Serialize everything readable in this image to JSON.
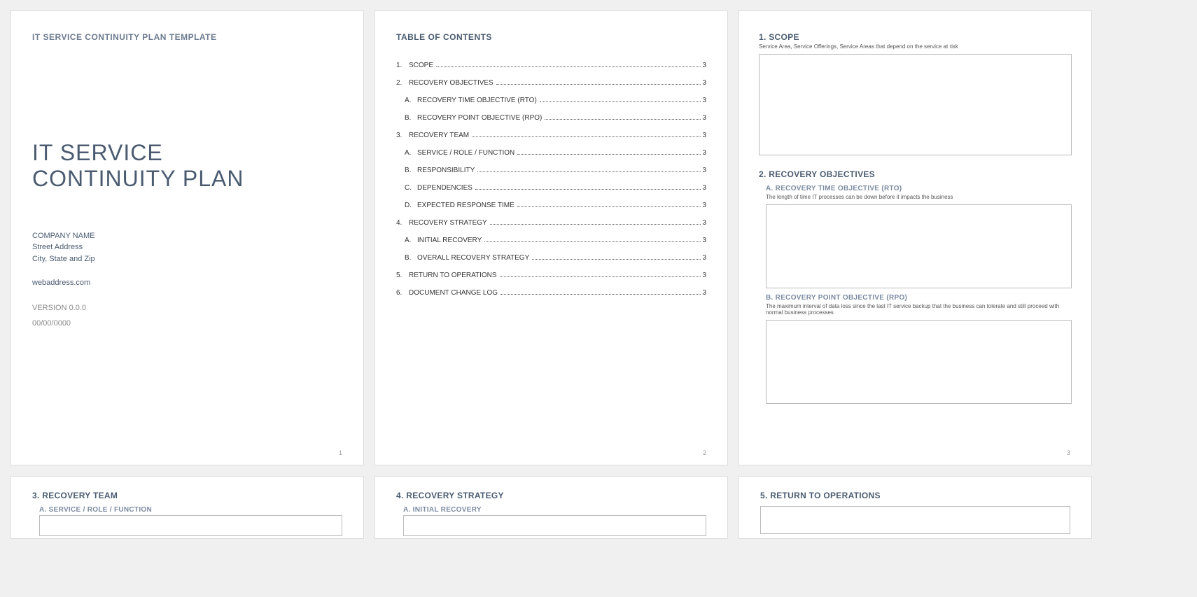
{
  "page1": {
    "template_label": "IT SERVICE CONTINUITY PLAN TEMPLATE",
    "title_line1": "IT SERVICE",
    "title_line2": "CONTINUITY PLAN",
    "company_name": "COMPANY NAME",
    "street": "Street Address",
    "city": "City, State and Zip",
    "web": "webaddress.com",
    "version": "VERSION 0.0.0",
    "date": "00/00/0000",
    "page_num": "1"
  },
  "page2": {
    "toc_title": "TABLE OF CONTENTS",
    "items": [
      {
        "num": "1.",
        "label": "SCOPE",
        "page": "3",
        "sub": false
      },
      {
        "num": "2.",
        "label": "RECOVERY OBJECTIVES",
        "page": "3",
        "sub": false
      },
      {
        "num": "A.",
        "label": "RECOVERY TIME OBJECTIVE (RTO)",
        "page": "3",
        "sub": true
      },
      {
        "num": "B.",
        "label": "RECOVERY POINT OBJECTIVE (RPO)",
        "page": "3",
        "sub": true
      },
      {
        "num": "3.",
        "label": "RECOVERY TEAM",
        "page": "3",
        "sub": false
      },
      {
        "num": "A.",
        "label": "SERVICE / ROLE / FUNCTION",
        "page": "3",
        "sub": true
      },
      {
        "num": "B.",
        "label": "RESPONSIBILITY",
        "page": "3",
        "sub": true
      },
      {
        "num": "C.",
        "label": "DEPENDENCIES",
        "page": "3",
        "sub": true
      },
      {
        "num": "D.",
        "label": "EXPECTED RESPONSE TIME",
        "page": "3",
        "sub": true
      },
      {
        "num": "4.",
        "label": "RECOVERY STRATEGY",
        "page": "3",
        "sub": false
      },
      {
        "num": "A.",
        "label": "INITIAL RECOVERY",
        "page": "3",
        "sub": true
      },
      {
        "num": "B.",
        "label": "OVERALL RECOVERY STRATEGY",
        "page": "3",
        "sub": true
      },
      {
        "num": "5.",
        "label": "RETURN TO OPERATIONS",
        "page": "3",
        "sub": false
      },
      {
        "num": "6.",
        "label": "DOCUMENT CHANGE LOG",
        "page": "3",
        "sub": false
      }
    ],
    "page_num": "2"
  },
  "page3": {
    "scope_h": "1.  SCOPE",
    "scope_desc": "Service Area, Service Offerings, Service Areas that depend on the service at risk",
    "ro_h": "2.  RECOVERY OBJECTIVES",
    "rto_h": "A.  RECOVERY TIME OBJECTIVE (RTO)",
    "rto_desc": "The length of time IT processes can be down before it impacts the business",
    "rpo_h": "B.  RECOVERY POINT OBJECTIVE (RPO)",
    "rpo_desc": "The maximum interval of data loss since the last IT service backup that the business can tolerate and still proceed with normal business processes",
    "page_num": "3"
  },
  "page4": {
    "h": "3.  RECOVERY TEAM",
    "sub": "A.  SERVICE / ROLE / FUNCTION"
  },
  "page5": {
    "h": "4.  RECOVERY STRATEGY",
    "sub": "A.  INITIAL RECOVERY"
  },
  "page6": {
    "h": "5.  RETURN TO OPERATIONS"
  }
}
